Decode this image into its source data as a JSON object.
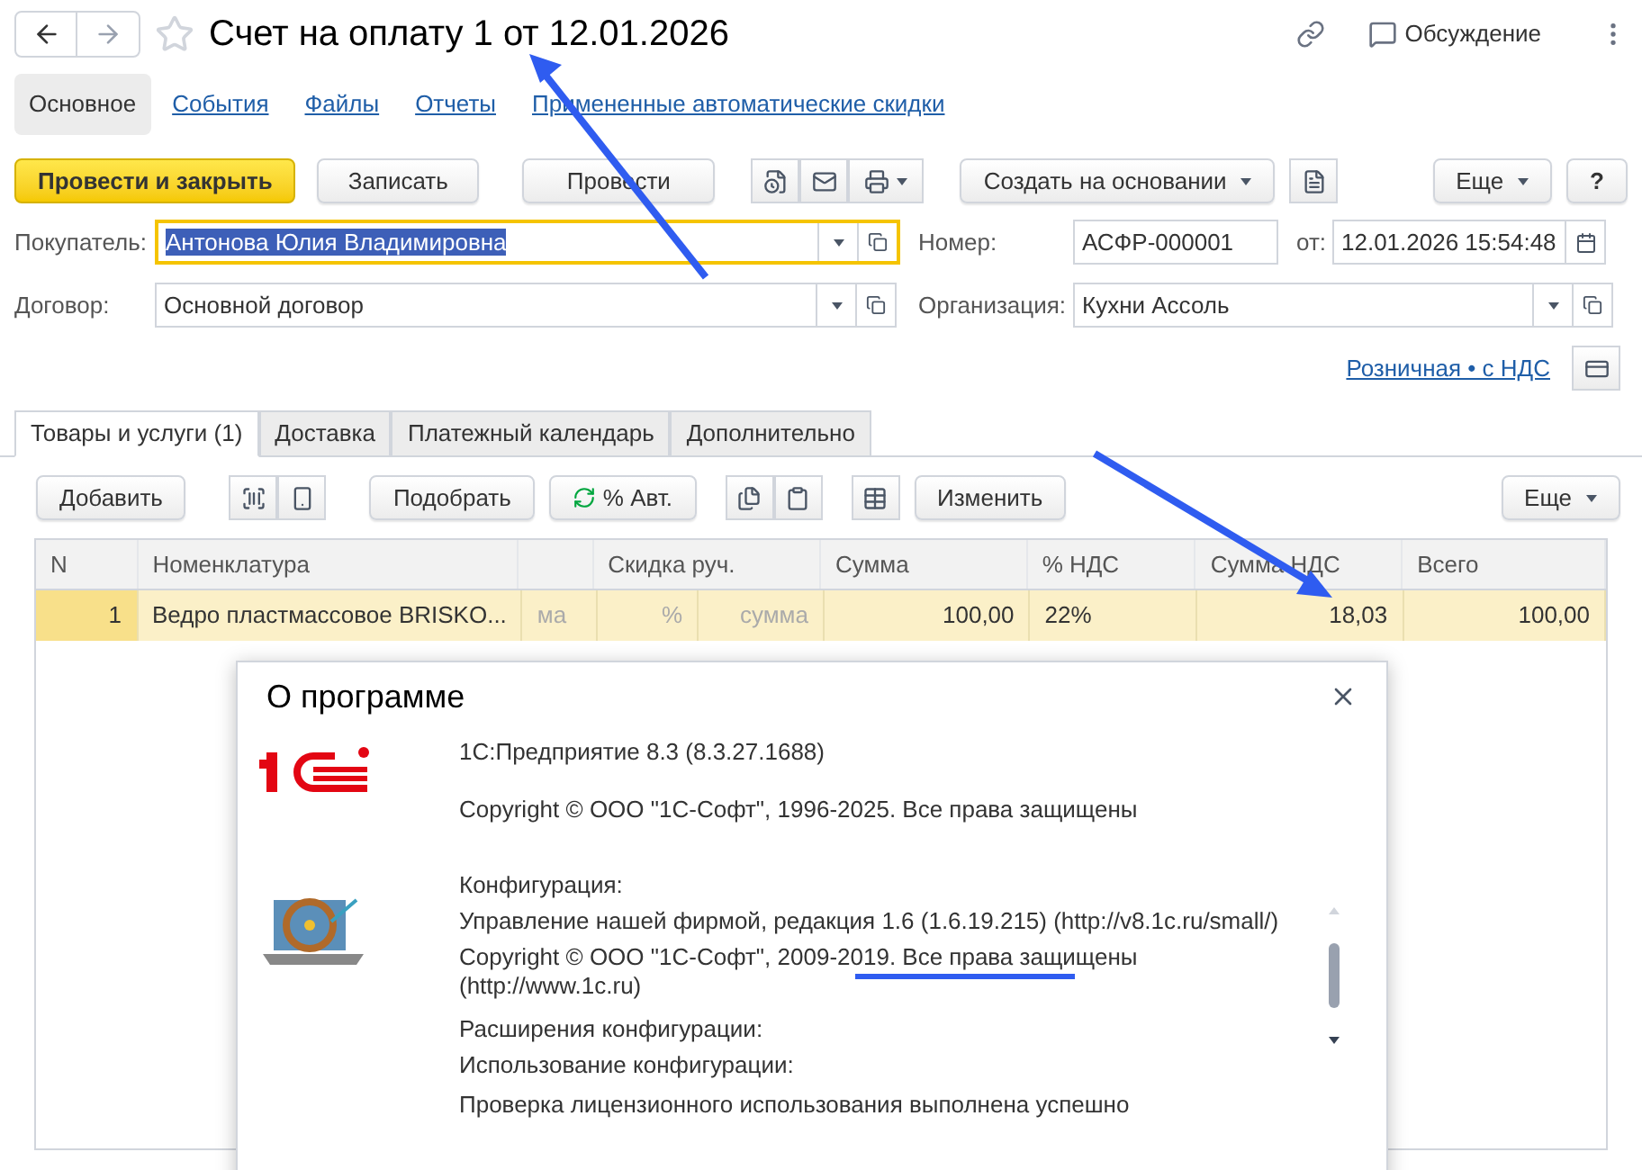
{
  "header": {
    "title": "Счет на оплату 1 от 12.01.2026",
    "discussion": "Обсуждение"
  },
  "nav": [
    {
      "label": "Основное",
      "selected": true
    },
    {
      "label": "События",
      "selected": false
    },
    {
      "label": "Файлы",
      "selected": false
    },
    {
      "label": "Отчеты",
      "selected": false
    },
    {
      "label": "Примененные автоматические скидки",
      "selected": false
    }
  ],
  "toolbar": {
    "post_close": "Провести и закрыть",
    "write": "Записать",
    "post": "Провести",
    "create_based": "Создать на основании",
    "more": "Еще",
    "help": "?"
  },
  "fields": {
    "buyer": {
      "label": "Покупатель:",
      "value": "Антонова Юлия Владимировна",
      "selected": true
    },
    "contract": {
      "label": "Договор:",
      "value": "Основной договор"
    },
    "number": {
      "label": "Номер:",
      "value": "АСФР-000001"
    },
    "date": {
      "label": "от:",
      "value": "12.01.2026 15:54:48"
    },
    "organization": {
      "label": "Организация:",
      "value": "Кухни Ассоль"
    }
  },
  "price_link": "Розничная • с НДС",
  "tabs": [
    {
      "label": "Товары и услуги (1)",
      "selected": true
    },
    {
      "label": "Доставка",
      "selected": false
    },
    {
      "label": "Платежный календарь",
      "selected": false
    },
    {
      "label": "Дополнительно",
      "selected": false
    }
  ],
  "table_toolbar": {
    "add": "Добавить",
    "pick": "Подобрать",
    "auto": "% Авт.",
    "change": "Изменить",
    "more": "Еще"
  },
  "table": {
    "columns": [
      "N",
      "Номенклатура",
      "",
      "Скидка руч.",
      "",
      "Сумма",
      "% НДС",
      "Сумма НДС",
      "Всего"
    ],
    "rows": [
      {
        "selected": true,
        "cells": [
          {
            "text": "1",
            "hint": false
          },
          {
            "text": "Ведро пластмассовое BRISKO...",
            "hint": false
          },
          {
            "text": "ма",
            "hint": true
          },
          {
            "text": "%",
            "hint": true
          },
          {
            "text": "сумма",
            "hint": true
          },
          {
            "text": "100,00",
            "hint": false
          },
          {
            "text": "22%",
            "hint": false
          },
          {
            "text": "18,03",
            "hint": false
          },
          {
            "text": "100,00",
            "hint": false
          }
        ]
      }
    ]
  },
  "dialog": {
    "title": "О программе",
    "platform": [
      "1С:Предприятие 8.3 (8.3.27.1688)",
      "Copyright © ООО \"1С-Софт\", 1996-2025. Все права защищены"
    ],
    "config_label": "Конфигурация:",
    "config": [
      "Управление нашей фирмой, редакция 1.6 (1.6.19.215) (http://v8.1c.ru/small/)",
      "Copyright © ООО \"1С-Софт\", 2009-2019. Все права защищены",
      "(http://www.1c.ru)"
    ],
    "extensions_label": "Расширения конфигурации:",
    "usage_label": "Использование конфигурации:",
    "usage": "Проверка лицензионного использования выполнена успешно"
  }
}
